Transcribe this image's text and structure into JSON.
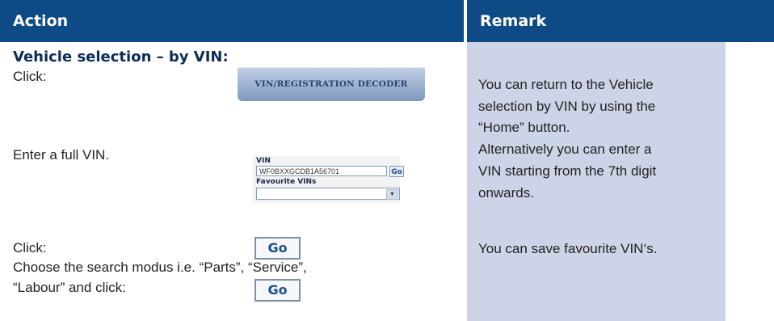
{
  "header": {
    "action": "Action",
    "remark": "Remark"
  },
  "section_title": "Vehicle selection – by VIN:",
  "steps": {
    "click1": "Click:",
    "decoder_button": "VIN/REGISTRATION DECODER",
    "enter_vin": "Enter a full VIN.",
    "vin_widget": {
      "vin_label": "VIN",
      "vin_value": "WF0BXXGCDB1A56701",
      "go_label": "Go",
      "favourite_label": "Favourite VINs",
      "favourite_value": ""
    },
    "click2": "Click:",
    "go_button": "Go",
    "choose_line1": "Choose the search modus i.e. “Parts”, “Service”,",
    "choose_line2": "“Labour” and click:",
    "go_button2": "Go"
  },
  "remarks": {
    "r1_l1": "You can return to the Vehicle",
    "r1_l2": "selection by VIN by using the",
    "r1_l3": "“Home” button.",
    "r1_l4": "Alternatively you can enter a",
    "r1_l5": "VIN starting from the 7th digit",
    "r1_l6": "onwards.",
    "r2": "You can save favourite VIN‘s."
  }
}
